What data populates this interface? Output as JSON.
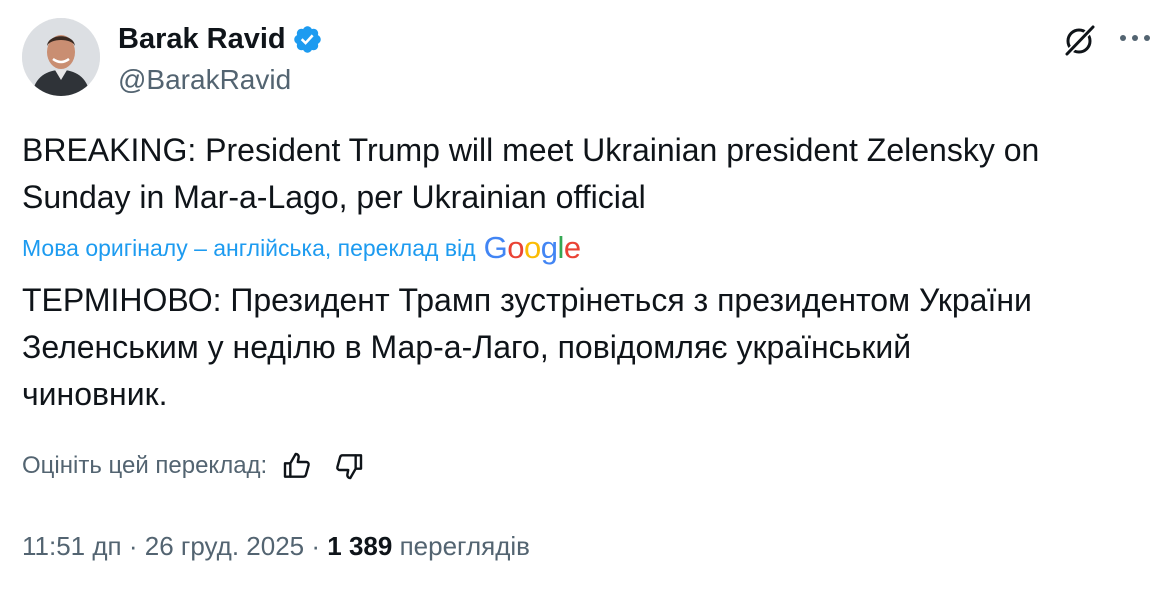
{
  "author": {
    "name": "Barak Ravid",
    "handle": "@BarakRavid",
    "verified": true,
    "avatar": "person-photo-avatar"
  },
  "icons": {
    "verified": "verified-badge-icon",
    "grok": "grok-icon",
    "more": "more-options-icon",
    "like": "thumbs-up-icon",
    "dislike": "thumbs-down-icon"
  },
  "post": {
    "text": "BREAKING: President Trump will meet Ukrainian president Zelensky on\nSunday in Mar-a-Lago, per Ukrainian official"
  },
  "translation": {
    "note": "Мова оригіналу – англійська, переклад від",
    "provider": "Google",
    "text": "ТЕРМІНОВО: Президент Трамп зустрінеться з президентом України\nЗеленським у неділю в Мар-а-Лаго, повідомляє український\nчиновник.",
    "rate_label": "Оцініть цей переклад:"
  },
  "meta": {
    "time": "11:51 дп",
    "separator": "·",
    "date": "26 груд. 2025",
    "views_count": "1 389",
    "views_label": "переглядів"
  },
  "colors": {
    "text": "#0f1419",
    "secondary": "#536471",
    "link": "#1d9bf0",
    "verified": "#1d9bf0"
  }
}
